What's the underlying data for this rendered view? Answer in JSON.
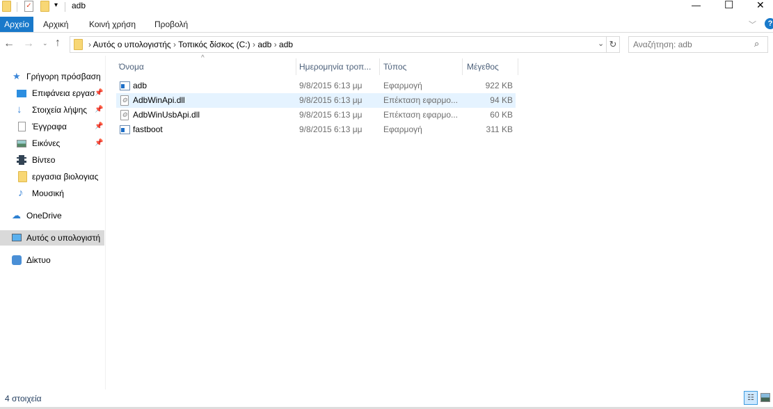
{
  "title_bar": {
    "title": "adb",
    "minimize": "—",
    "maximize": "☐",
    "close": "✕"
  },
  "ribbon": {
    "tabs": [
      {
        "label": "Αρχείο",
        "active": true
      },
      {
        "label": "Αρχική"
      },
      {
        "label": "Κοινή χρήση"
      },
      {
        "label": "Προβολή"
      }
    ],
    "help": "?"
  },
  "address": {
    "crumbs": [
      "Αυτός ο υπολογιστής",
      "Τοπικός δίσκος (C:)",
      "adb",
      "adb"
    ],
    "search_placeholder": "Αναζήτηση: adb"
  },
  "nav": {
    "quick_access": "Γρήγορη πρόσβαση",
    "items": [
      {
        "label": "Επιφάνεια εργασ",
        "pinned": true
      },
      {
        "label": "Στοιχεία λήψης",
        "pinned": true
      },
      {
        "label": "Έγγραφα",
        "pinned": true
      },
      {
        "label": "Εικόνες",
        "pinned": true
      },
      {
        "label": "Βίντεο"
      },
      {
        "label": "εργασια βιολογιας"
      },
      {
        "label": "Μουσική"
      }
    ],
    "onedrive": "OneDrive",
    "this_pc": "Αυτός ο υπολογιστή",
    "network": "Δίκτυο"
  },
  "columns": {
    "name": "Όνομα",
    "date": "Ημερομηνία τροπ...",
    "type": "Τύπος",
    "size": "Μέγεθος"
  },
  "files": [
    {
      "name": "adb",
      "date": "9/8/2015 6:13 μμ",
      "type": "Εφαρμογή",
      "size": "922 KB",
      "kind": "exe"
    },
    {
      "name": "AdbWinApi.dll",
      "date": "9/8/2015 6:13 μμ",
      "type": "Επέκταση εφαρμο...",
      "size": "94 KB",
      "kind": "dll"
    },
    {
      "name": "AdbWinUsbApi.dll",
      "date": "9/8/2015 6:13 μμ",
      "type": "Επέκταση εφαρμο...",
      "size": "60 KB",
      "kind": "dll"
    },
    {
      "name": "fastboot",
      "date": "9/8/2015 6:13 μμ",
      "type": "Εφαρμογή",
      "size": "311 KB",
      "kind": "exe"
    }
  ],
  "status": {
    "count": "4 στοιχεία"
  },
  "colors": {
    "accent": "#1979ca",
    "hover": "#e5f3ff",
    "selected": "#d9d9d9"
  }
}
